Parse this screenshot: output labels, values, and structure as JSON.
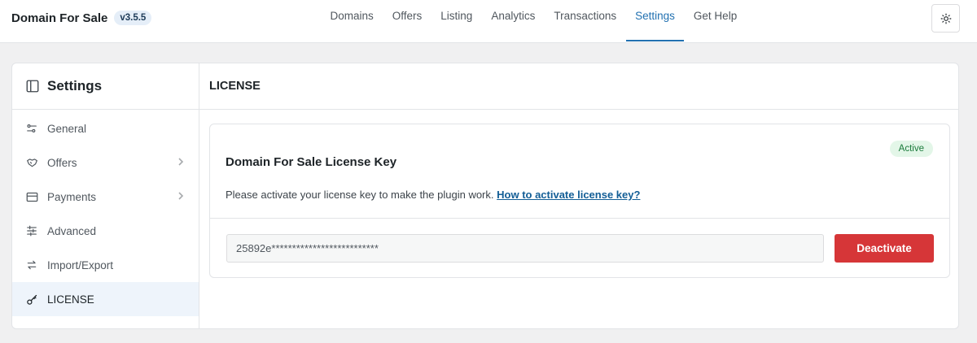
{
  "header": {
    "brand": "Domain For Sale",
    "version": "v3.5.5",
    "nav": [
      "Domains",
      "Offers",
      "Listing",
      "Analytics",
      "Transactions",
      "Settings",
      "Get Help"
    ],
    "active_nav": "Settings",
    "theme_icon": "sun-icon"
  },
  "sidebar": {
    "title": "Settings",
    "title_icon": "sidebar-panel-icon",
    "items": [
      {
        "label": "General",
        "icon": "sliders-icon",
        "chevron": false
      },
      {
        "label": "Offers",
        "icon": "handshake-icon",
        "chevron": true
      },
      {
        "label": "Payments",
        "icon": "credit-card-icon",
        "chevron": true
      },
      {
        "label": "Advanced",
        "icon": "adjustments-icon",
        "chevron": false
      },
      {
        "label": "Import/Export",
        "icon": "arrows-exchange-icon",
        "chevron": false
      },
      {
        "label": "LICENSE",
        "icon": "key-icon",
        "chevron": false
      }
    ],
    "active_item": "LICENSE"
  },
  "main": {
    "title": "LICENSE",
    "license": {
      "status": "Active",
      "title": "Domain For Sale License Key",
      "description": "Please activate your license key to make the plugin work.",
      "help_link": "How to activate license key?",
      "key_value": "25892e**************************",
      "button": "Deactivate"
    }
  },
  "colors": {
    "accent": "#2271b1",
    "danger": "#d63638",
    "active_badge_bg": "#e3f6e8",
    "active_badge_text": "#1a7a3a"
  }
}
